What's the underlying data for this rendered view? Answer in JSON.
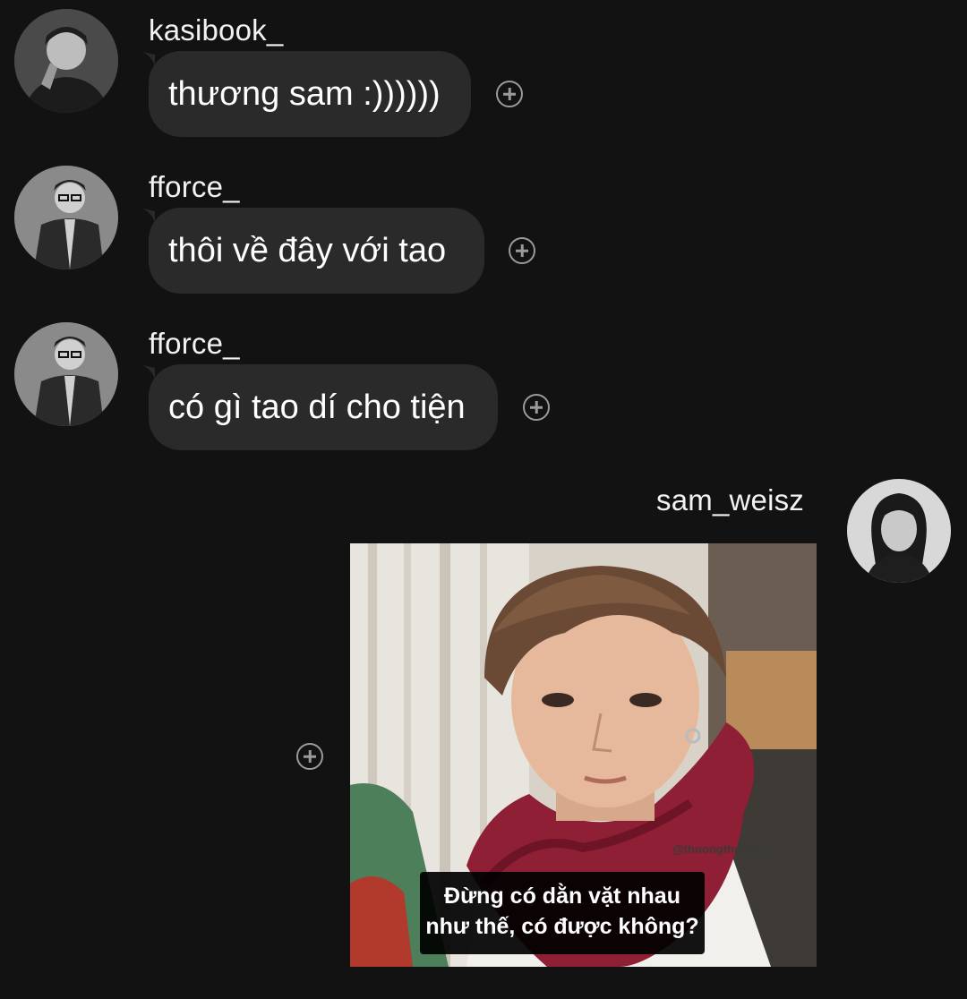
{
  "messages": [
    {
      "username": "kasibook_",
      "text": "thương sam :))))))",
      "avatar_icon": "avatar-kasibook"
    },
    {
      "username": "fforce_",
      "text": "thôi về đây với tao",
      "avatar_icon": "avatar-fforce"
    },
    {
      "username": "fforce_",
      "text": "có gì tao dí cho tiện",
      "avatar_icon": "avatar-fforce"
    }
  ],
  "own_message": {
    "username": "sam_weisz",
    "avatar_icon": "avatar-sam-weisz",
    "image": {
      "caption_line1": "Đừng có dằn vặt nhau",
      "caption_line2": "như thế, có được không?",
      "watermark": "@thuongthuong"
    }
  },
  "colors": {
    "background": "#121212",
    "bubble": "#2a2a2a",
    "react_icon": "#9a9a9a"
  }
}
